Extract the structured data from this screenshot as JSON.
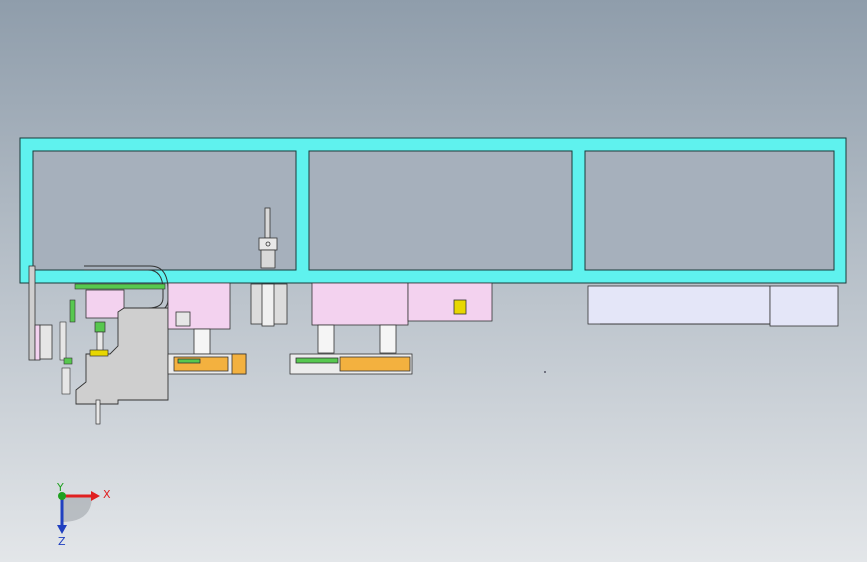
{
  "view": {
    "background_top": "#8f9dab",
    "background_bottom": "#e3e6e9"
  },
  "colors": {
    "frame": "#5ff2ee",
    "frame_outline": "#1a3a3a",
    "pink": "#f3d2ef",
    "light_grey": "#cfcfcf",
    "steel": "#d9d9d9",
    "lavender": "#e4e6f8",
    "orange": "#f3b13f",
    "green": "#57c84f",
    "yellow": "#e8d700",
    "axis_x": "#e02020",
    "axis_y": "#20a020",
    "axis_z": "#2040c0"
  },
  "axes": {
    "x_label": "X",
    "y_label": "Y",
    "z_label": "Z"
  }
}
